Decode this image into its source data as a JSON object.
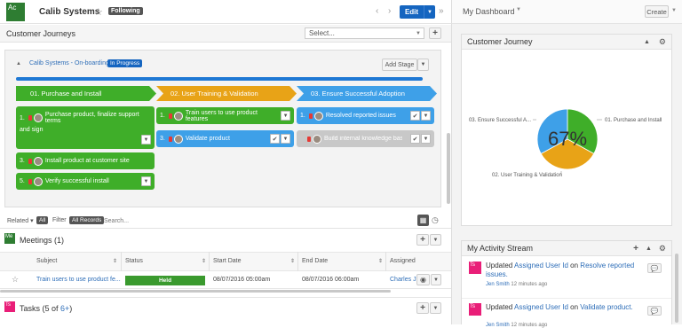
{
  "header": {
    "avatar": "Ac",
    "title": "Calib Systems",
    "following": "Following",
    "edit": "Edit",
    "dashboard": "My Dashboard",
    "create": "Create"
  },
  "customer_journeys": {
    "label": "Customer Journeys",
    "select_placeholder": "Select...",
    "journey_title": "Calib Systems - On-boarding",
    "status": "In Progress",
    "add_stage": "Add Stage",
    "progress": 1.0,
    "stages": [
      {
        "label": "01. Purchase and Install",
        "color": "#3fae29"
      },
      {
        "label": "02. User Training & Validation",
        "color": "#e8a317"
      },
      {
        "label": "03. Ensure Successful Adoption",
        "color": "#3ea0e8"
      }
    ],
    "tasks": {
      "s1": [
        {
          "num": "1.",
          "text": "Purchase product, finalize support terms",
          "text2": "and sign"
        },
        {
          "num": "3.",
          "text": "Install product at customer site"
        },
        {
          "num": "5.",
          "text": "Verify successful install"
        }
      ],
      "s2": [
        {
          "num": "1.",
          "text": "Train users to use product features"
        },
        {
          "num": "3.",
          "text": "Validate product"
        }
      ],
      "s3": [
        {
          "num": "1.",
          "text": "Resolved reported issues"
        },
        {
          "num": "",
          "text": "Build internal knowledge base"
        }
      ]
    }
  },
  "filterbar": {
    "related": "Related",
    "all": "All",
    "filter": "Filter",
    "all_records": "All Records",
    "search_placeholder": "Search..."
  },
  "meetings": {
    "icon": "Me",
    "title": "Meetings (1)",
    "columns": [
      "Subject",
      "Status",
      "Start Date",
      "End Date",
      "Assigned"
    ],
    "row": {
      "subject": "Train users to use product fe...",
      "status": "Held",
      "start": "08/07/2016 05:00am",
      "end": "08/07/2016 06:00am",
      "assigned": "Charles J"
    }
  },
  "tasks": {
    "icon": "Ts",
    "title_prefix": "Tasks (5 of ",
    "title_link": "6+",
    "title_suffix": ")"
  },
  "journey_dashlet": {
    "title": "Customer Journey",
    "center_label": "67%",
    "chart_data": {
      "type": "pie",
      "categories": [
        "01. Purchase and Install",
        "02. User Training & Validation",
        "03. Ensure Successful A..."
      ],
      "values": [
        33,
        34,
        33
      ],
      "colors": [
        "#3fae29",
        "#e8a317",
        "#3ea0e8"
      ]
    }
  },
  "activity": {
    "title": "My Activity Stream",
    "items": [
      {
        "icon": "Ts",
        "prefix": "Updated ",
        "link1": "Assigned User Id",
        "mid": " on ",
        "link2": "Resolve reported issues.",
        "author": "Jen Smith",
        "time": "12 minutes ago"
      },
      {
        "icon": "Ts",
        "prefix": "Updated ",
        "link1": "Assigned User Id",
        "mid": " on ",
        "link2": "Validate product.",
        "author": "Jen Smith",
        "time": "12 minutes ago"
      }
    ]
  }
}
